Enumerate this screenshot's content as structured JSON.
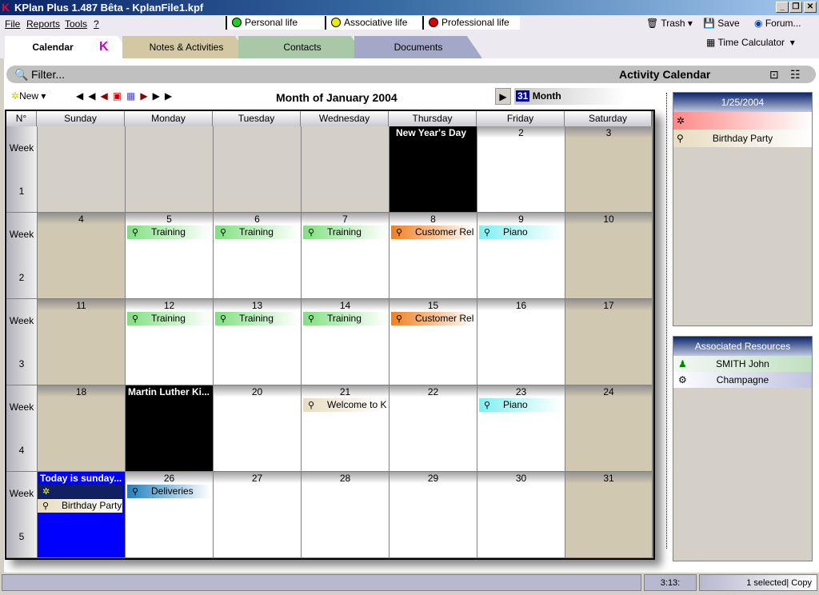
{
  "window": {
    "title": "KPlan Plus 1.487 Bêta - KplanFile1.kpf",
    "minimize": "_",
    "restore": "❐",
    "close": "✕"
  },
  "menu": [
    "File",
    "Reports",
    "Tools",
    "?"
  ],
  "life_tabs": [
    {
      "label": "Personal life",
      "color": "#22cc22"
    },
    {
      "label": "Associative life",
      "color": "#eeee00"
    },
    {
      "label": "Professional life",
      "color": "#dd0000"
    }
  ],
  "toolbar": {
    "trash": "Trash",
    "save": "Save",
    "forum": "Forum...",
    "time_calculator": "Time Calculator"
  },
  "tabs": [
    {
      "label": "Calendar",
      "color": "#ffffff"
    },
    {
      "label": "Notes & Activities",
      "color": "#d4c8a4"
    },
    {
      "label": "Contacts",
      "color": "#a8c8a8"
    },
    {
      "label": "Documents",
      "color": "#a4a8c8"
    }
  ],
  "filter": {
    "label": "Filter...",
    "title": "Activity Calendar"
  },
  "calendar": {
    "new_label": "New",
    "title": "Month of January 2004",
    "view_label": "Month",
    "view_icon": "31",
    "week_col": "N°",
    "days": [
      "Sunday",
      "Monday",
      "Tuesday",
      "Wednesday",
      "Thursday",
      "Friday",
      "Saturday"
    ],
    "week_label": "Week",
    "weeks": [
      [
        {
          "t": "empty"
        },
        {
          "t": "empty"
        },
        {
          "t": "empty"
        },
        {
          "t": "empty"
        },
        {
          "t": "holiday",
          "title": "New Year's Day"
        },
        {
          "t": "white",
          "day": "2"
        },
        {
          "t": "weekend",
          "day": "3"
        }
      ],
      [
        {
          "t": "weekend",
          "day": "4"
        },
        {
          "t": "white",
          "day": "5",
          "ev": [
            {
              "l": "Training",
              "c": "green"
            }
          ]
        },
        {
          "t": "white",
          "day": "6",
          "ev": [
            {
              "l": "Training",
              "c": "green"
            }
          ]
        },
        {
          "t": "white",
          "day": "7",
          "ev": [
            {
              "l": "Training",
              "c": "green"
            }
          ]
        },
        {
          "t": "white",
          "day": "8",
          "ev": [
            {
              "l": "Customer Relat...",
              "c": "orange"
            }
          ]
        },
        {
          "t": "white",
          "day": "9",
          "ev": [
            {
              "l": "Piano",
              "c": "cyan"
            }
          ]
        },
        {
          "t": "weekend",
          "day": "10"
        }
      ],
      [
        {
          "t": "weekend",
          "day": "11"
        },
        {
          "t": "white",
          "day": "12",
          "ev": [
            {
              "l": "Training",
              "c": "green"
            }
          ]
        },
        {
          "t": "white",
          "day": "13",
          "ev": [
            {
              "l": "Training",
              "c": "green"
            }
          ]
        },
        {
          "t": "white",
          "day": "14",
          "ev": [
            {
              "l": "Training",
              "c": "green"
            }
          ]
        },
        {
          "t": "white",
          "day": "15",
          "ev": [
            {
              "l": "Customer Relat...",
              "c": "orange"
            }
          ]
        },
        {
          "t": "white",
          "day": "16"
        },
        {
          "t": "weekend",
          "day": "17"
        }
      ],
      [
        {
          "t": "weekend",
          "day": "18"
        },
        {
          "t": "holiday",
          "title": "Martin Luther Ki..."
        },
        {
          "t": "white",
          "day": "20"
        },
        {
          "t": "white",
          "day": "21",
          "ev": [
            {
              "l": "Welcome to KP...",
              "c": "beige"
            }
          ]
        },
        {
          "t": "white",
          "day": "22"
        },
        {
          "t": "white",
          "day": "23",
          "ev": [
            {
              "l": "Piano",
              "c": "cyan"
            }
          ]
        },
        {
          "t": "weekend",
          "day": "24"
        }
      ],
      [
        {
          "t": "today",
          "title": "Today is sunday...",
          "ev": [
            {
              "l": "",
              "c": "navy"
            },
            {
              "l": "Birthday Party",
              "c": "beige"
            }
          ]
        },
        {
          "t": "white",
          "day": "26",
          "ev": [
            {
              "l": "Deliveries",
              "c": "blue"
            }
          ]
        },
        {
          "t": "white",
          "day": "27"
        },
        {
          "t": "white",
          "day": "28"
        },
        {
          "t": "white",
          "day": "29"
        },
        {
          "t": "white",
          "day": "30"
        },
        {
          "t": "weekend",
          "day": "31"
        }
      ]
    ]
  },
  "event_colors": {
    "green": "#80e080",
    "orange": "#f08020",
    "cyan": "#80f0f0",
    "beige": "#e8dcc0",
    "blue": "#2080c0",
    "navy": "#102060"
  },
  "day_panel": {
    "date": "1/25/2004",
    "items": [
      "",
      "Birthday Party"
    ]
  },
  "resources": {
    "title": "Associated Resources",
    "items": [
      "SMITH John",
      "Champagne"
    ]
  },
  "status": {
    "time": "3:13:",
    "selection": "1 selected|  Copy"
  }
}
